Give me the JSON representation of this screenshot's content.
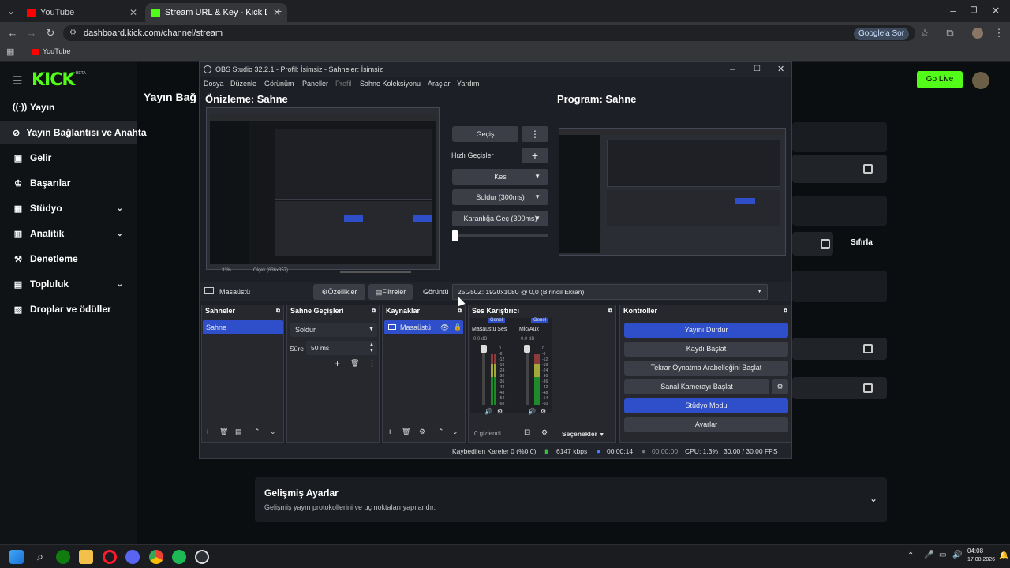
{
  "browser": {
    "tabs": [
      {
        "label": "YouTube",
        "favicon_color": "#ff0000"
      },
      {
        "label": "Stream URL & Key - Kick Dashb",
        "favicon_color": "#53fc18"
      }
    ],
    "url": "dashboard.kick.com/channel/stream",
    "ask_google": "Google'a Sor",
    "bookmark": "YouTube"
  },
  "kick": {
    "logo": "KICK",
    "beta": "BETA",
    "go_live": "Go Live",
    "partial_title": "Yayın Bağ",
    "sidebar": [
      {
        "label": "Yayın",
        "icon": "broadcast-icon"
      },
      {
        "label": "Yayın Bağlantısı ve Anahta",
        "icon": "link-icon",
        "active": true
      },
      {
        "label": "Gelir",
        "icon": "revenue-icon"
      },
      {
        "label": "Başarılar",
        "icon": "trophy-icon"
      },
      {
        "label": "Stüdyo",
        "icon": "studio-icon",
        "expandable": true
      },
      {
        "label": "Analitik",
        "icon": "chart-icon",
        "expandable": true
      },
      {
        "label": "Denetleme",
        "icon": "gavel-icon"
      },
      {
        "label": "Topluluk",
        "icon": "people-icon",
        "expandable": true
      },
      {
        "label": "Droplar ve ödüller",
        "icon": "gift-icon"
      }
    ],
    "reset": "Sıfırla",
    "advanced": {
      "title": "Gelişmiş Ayarlar",
      "subtitle": "Gelişmiş yayın protokollerini ve uç noktaları yapılandır."
    }
  },
  "obs": {
    "window_title": "OBS Studio 32.2.1 - Profil: İsimsiz - Sahneler: İsimsiz",
    "menu": [
      "Dosya",
      "Düzenle",
      "Görünüm",
      "Paneller",
      "Profil",
      "Sahne Koleksiyonu",
      "Araçlar",
      "Yardım"
    ],
    "preview_title": "Önizleme: Sahne",
    "program_title": "Program: Sahne",
    "transition": {
      "gecis": "Geçiş",
      "hizli": "Hızlı Geçişler",
      "kes": "Kes",
      "soldur": "Soldur (300ms)",
      "karanlik": "Karanlığa Geç (300ms)"
    },
    "source_bar": {
      "source": "Masaüstü",
      "properties": "Özellikler",
      "filters": "Filtreler",
      "display_label": "Görüntü",
      "display_value": "25G50Z: 1920x1080 @ 0,0 (Birincil Ekran)"
    },
    "preview_zoom": "33%",
    "preview_scale": "Ölçek (636x357)",
    "scenes": {
      "title": "Sahneler",
      "items": [
        "Sahne"
      ]
    },
    "transitions_dock": {
      "title": "Sahne Geçişleri",
      "type": "Soldur",
      "duration_label": "Süre",
      "duration": "50 ms"
    },
    "sources": {
      "title": "Kaynaklar",
      "items": [
        "Masaüstü"
      ]
    },
    "mixer": {
      "title": "Ses Karıştırıcı",
      "channels": [
        {
          "tag": "Genel",
          "name": "Masaüstü Ses",
          "db": "0.0 dB"
        },
        {
          "tag": "Genel",
          "name": "Mic/Aux",
          "db": "0.0 dB"
        }
      ],
      "scale": [
        "0",
        "-6",
        "-12",
        "-18",
        "-24",
        "-30",
        "-36",
        "-42",
        "-48",
        "-54",
        "-60"
      ],
      "hidden": "0 gizlendi",
      "options": "Seçenekler"
    },
    "controls": {
      "title": "Kontroller",
      "buttons": [
        "Yayını Durdur",
        "Kaydı Başlat",
        "Tekrar Oynatma Arabelleğini Başlat",
        "Sanal Kamerayı Başlat",
        "Stüdyo Modu",
        "Ayarlar"
      ]
    },
    "status": {
      "dropped": "Kaybedilen Kareler 0 (%0.0)",
      "bitrate": "6147 kbps",
      "stream_time": "00:00:14",
      "rec_time": "00:00:00",
      "cpu": "CPU: 1.3%",
      "fps": "30.00 / 30.00 FPS"
    }
  },
  "taskbar": {
    "time": "04:08",
    "date": "17.08.2026"
  }
}
